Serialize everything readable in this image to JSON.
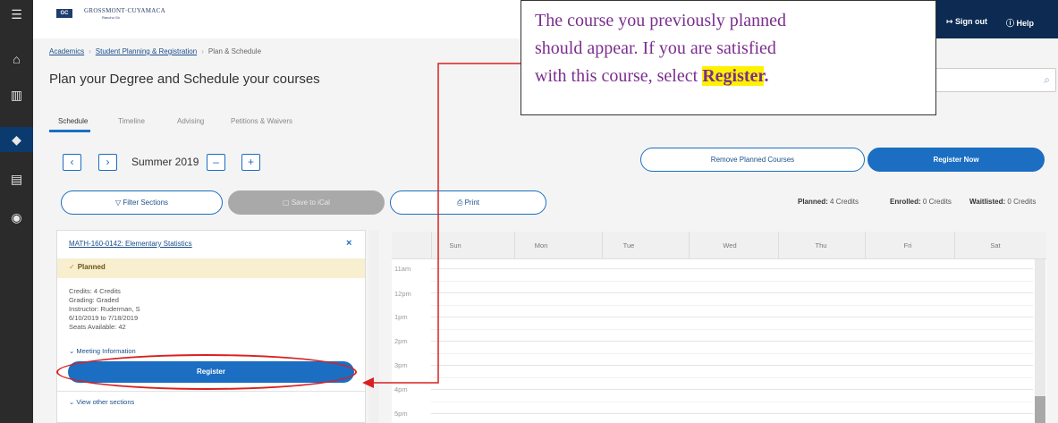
{
  "header": {
    "logo_badge": "GC",
    "logo_name": "GROSSMONT·CUYAMACA",
    "logo_sub": "Rancho Gc",
    "sign_out": "Sign out",
    "help": "Help",
    "sign_out_icon": "sign-out-arrow-icon",
    "help_icon": "question-circle-icon"
  },
  "sidebar": {
    "items": [
      {
        "name": "menu-icon",
        "glyph": "☰"
      },
      {
        "name": "home-icon",
        "glyph": "⌂"
      },
      {
        "name": "bank-icon",
        "glyph": "🏛"
      },
      {
        "name": "graduation-cap-icon",
        "glyph": "🎓"
      },
      {
        "name": "document-icon",
        "glyph": "▤"
      },
      {
        "name": "user-circle-icon",
        "glyph": "◉"
      }
    ]
  },
  "breadcrumb": {
    "items": [
      "Academics",
      "Student Planning & Registration",
      "Plan & Schedule"
    ]
  },
  "page_title": "Plan your Degree and Schedule your courses",
  "tabs": [
    "Schedule",
    "Timeline",
    "Advising",
    "Petitions & Waivers"
  ],
  "term": {
    "prev": "‹",
    "next": "›",
    "label": "Summer 2019",
    "remove": "–",
    "add": "+"
  },
  "actions": {
    "remove_planned": "Remove Planned Courses",
    "register_now": "Register Now",
    "filter_sections": "Filter Sections",
    "save_ical": "Save to iCal",
    "print": "Print"
  },
  "credits": {
    "planned_label": "Planned:",
    "planned_value": "4 Credits",
    "enrolled_label": "Enrolled:",
    "enrolled_value": "0 Credits",
    "waitlisted_label": "Waitlisted:",
    "waitlisted_value": "0 Credits"
  },
  "course": {
    "title": "MATH-160-0142: Elementary Statistics",
    "close": "×",
    "status": "Planned",
    "credits": "Credits: 4 Credits",
    "grading": "Grading: Graded",
    "instructor": "Instructor: Ruderman, S",
    "dates": "6/10/2019 to 7/18/2019",
    "seats": "Seats Available:  42",
    "meeting": "Meeting Information",
    "register": "Register",
    "other_sections": "View other sections"
  },
  "calendar": {
    "days": [
      "Sun",
      "Mon",
      "Tue",
      "Wed",
      "Thu",
      "Fri",
      "Sat"
    ],
    "hours": [
      "11am",
      "12pm",
      "1pm",
      "2pm",
      "3pm",
      "4pm",
      "5pm"
    ]
  },
  "callout": {
    "line1": "The course you previously planned",
    "line2": "should appear. If you are satisfied",
    "line3": "with this course, select",
    "highlight": "Register",
    "period": "."
  },
  "colors": {
    "accent": "#1b6ec2",
    "annotation_red": "#d92020",
    "callout_text": "#7b2e8e",
    "highlight": "#fff200"
  }
}
